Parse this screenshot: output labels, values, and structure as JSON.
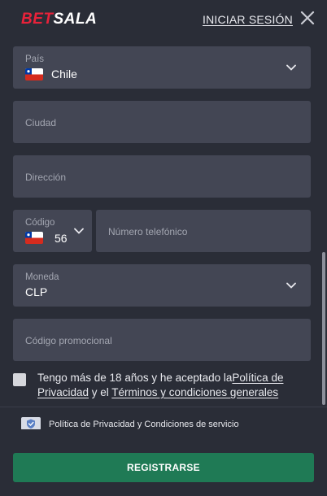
{
  "header": {
    "logo_part1": "BET",
    "logo_part2": "SALA",
    "login_label": "INICIAR SESIÓN"
  },
  "form": {
    "country": {
      "label": "País",
      "value": "Chile"
    },
    "city": {
      "placeholder": "Ciudad"
    },
    "address": {
      "placeholder": "Dirección"
    },
    "phone_code": {
      "label": "Código",
      "value": "56"
    },
    "phone_number": {
      "placeholder": "Número telefónico"
    },
    "currency": {
      "label": "Moneda",
      "value": "CLP"
    },
    "promo": {
      "placeholder": "Código promocional"
    }
  },
  "consent": {
    "text_before": "Tengo más de 18 años y he aceptado la",
    "privacy_link": "Política de Privacidad",
    "text_middle": " y el ",
    "terms_link": "Términos y condiciones generales"
  },
  "policy_notice": "Política de Privacidad y Condiciones de servicio",
  "register_label": "REGISTRARSE",
  "colors": {
    "background": "#2a2d37",
    "field": "#434654",
    "brand_red": "#e8223a",
    "button_green": "#1f7a55"
  }
}
